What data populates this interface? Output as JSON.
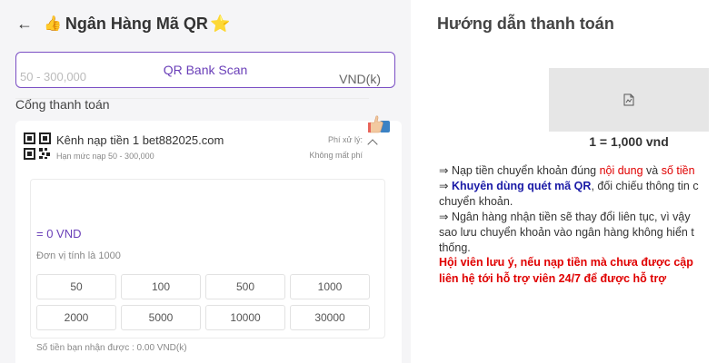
{
  "header": {
    "back_icon": "arrow-left-icon",
    "emoji": "👍",
    "title": "Ngân Hàng Mã QR",
    "star": "⭐"
  },
  "qr_button": {
    "label": "QR Bank Scan"
  },
  "section": {
    "label": "Cổng thanh toán"
  },
  "channel": {
    "name": "Kênh nạp tiền 1 bet882025.com",
    "limit": "Hạn mức nạp 50 - 300,000",
    "fee_label": "Phí xử lý:",
    "fee_value": "Không mất phí"
  },
  "amount": {
    "placeholder": "50 - 300,000",
    "unit": "VND(k)",
    "converted": "= 0 VND",
    "unit_note": "Đơn vị tính là 1000",
    "presets": [
      "50",
      "100",
      "500",
      "1000",
      "2000",
      "5000",
      "10000",
      "30000"
    ],
    "receive_note": "Số tiền bạn nhận được : 0.00 VND(k)"
  },
  "guide": {
    "title": "Hướng dẫn thanh toán",
    "rate": "1 = 1,000 vnd",
    "l1_a": "⇒ Nạp tiền chuyển khoản đúng ",
    "l1_b": "nội dung",
    "l1_c": " và ",
    "l1_d": "số tiền",
    "l2_a": "⇒ ",
    "l2_b": "Khuyên dùng quét mã QR",
    "l2_c": ", đối chiếu thông tin c",
    "l3": "chuyển khoản.",
    "l4": "⇒ Ngân hàng nhận tiền sẽ thay đổi liên tục, vì vậy",
    "l5": "sao lưu chuyển khoản vào ngân hàng không hiển t",
    "l6": "thống.",
    "w1": "Hội viên lưu ý, nếu nạp tiền mà chưa được cập",
    "w2": "liên hệ tới hỗ trợ viên 24/7 để được hỗ trợ"
  },
  "colors": {
    "accent": "#6a3fb8",
    "warning": "#e00000",
    "link_blue": "#1a1aa6"
  }
}
